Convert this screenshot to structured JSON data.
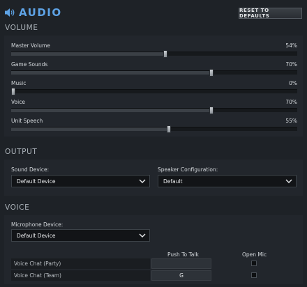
{
  "header": {
    "title": "AUDIO",
    "reset_label": "RESET TO DEFAULTS"
  },
  "volume": {
    "title": "VOLUME",
    "sliders": [
      {
        "label": "Master Volume",
        "value_text": "54%",
        "value": 0.54
      },
      {
        "label": "Game Sounds",
        "value_text": "70%",
        "value": 0.7
      },
      {
        "label": "Music",
        "value_text": "0%",
        "value": 0.0
      },
      {
        "label": "Voice",
        "value_text": "70%",
        "value": 0.7
      },
      {
        "label": "Unit Speech",
        "value_text": "55%",
        "value": 0.55
      }
    ]
  },
  "output": {
    "title": "OUTPUT",
    "sound_device_label": "Sound Device:",
    "sound_device_value": "Default Device",
    "speaker_config_label": "Speaker Configuration:",
    "speaker_config_value": "Default"
  },
  "voice": {
    "title": "VOICE",
    "mic_label": "Microphone Device:",
    "mic_value": "Default Device",
    "push_to_talk_header": "Push To Talk",
    "open_mic_header": "Open Mic",
    "rows": [
      {
        "label": "Voice Chat (Party)",
        "key": "",
        "open_mic": false
      },
      {
        "label": "Voice Chat (Team)",
        "key": "G",
        "open_mic": false
      }
    ]
  },
  "colors": {
    "accent": "#5ea3e6",
    "background": "#1e2227",
    "panel": "#22262c"
  },
  "icons": {
    "header": "speaker-icon",
    "dropdown": "chevron-down-icon"
  }
}
